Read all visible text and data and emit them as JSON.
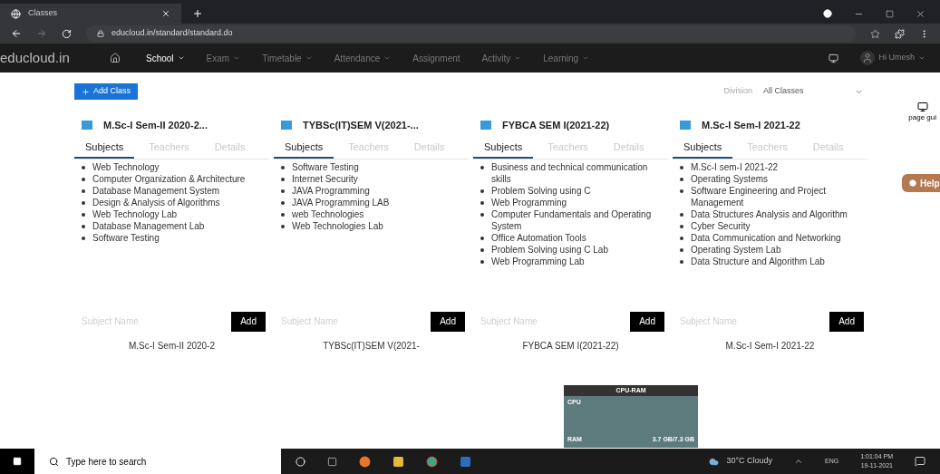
{
  "browser": {
    "tab_title": "Classes",
    "url": "educloud.in/standard/standard.do"
  },
  "navbar": {
    "brand": "educloud.in",
    "items": [
      {
        "label": "School",
        "dropdown": true,
        "selected": true
      },
      {
        "label": "Exam",
        "dropdown": true,
        "selected": false
      },
      {
        "label": "Timetable",
        "dropdown": true,
        "selected": false
      },
      {
        "label": "Attendance",
        "dropdown": true,
        "selected": false
      },
      {
        "label": "Assignment",
        "dropdown": false,
        "selected": false
      },
      {
        "label": "Activity",
        "dropdown": true,
        "selected": false
      },
      {
        "label": "Learning",
        "dropdown": true,
        "selected": false
      }
    ],
    "user": "Hi Umesh"
  },
  "toolbar": {
    "add_button": "Add Class",
    "division_label": "Division",
    "division_value": "All Classes"
  },
  "classes": [
    {
      "title": "M.Sc-I Sem-II 2020-2...",
      "tabs": [
        {
          "label": "Subjects",
          "selected": true
        },
        {
          "label": "Teachers",
          "selected": false
        },
        {
          "label": "Details",
          "selected": false
        }
      ],
      "subjects": [
        "Web Technology",
        "Computer Organization & Architecture",
        "Database Management System",
        "Design & Analysis of Algorithms",
        "Web Technology Lab",
        "Database Management Lab",
        "Software Testing"
      ],
      "placeholder": "Subject Name",
      "add": "Add",
      "caption": "M.Sc-I Sem-II 2020-2"
    },
    {
      "title": "TYBSc(IT)SEM V(2021-...",
      "tabs": [
        {
          "label": "Subjects",
          "selected": true
        },
        {
          "label": "Teachers",
          "selected": false
        },
        {
          "label": "Details",
          "selected": false
        }
      ],
      "subjects": [
        "Software Testing",
        "Internet Security",
        "JAVA Programming",
        "JAVA Programming LAB",
        "web Technologies",
        "Web Technologies Lab"
      ],
      "placeholder": "Subject Name",
      "add": "Add",
      "caption": "TYBSc(IT)SEM V(2021-"
    },
    {
      "title": "FYBCA SEM I(2021-22)",
      "tabs": [
        {
          "label": "Subjects",
          "selected": true
        },
        {
          "label": "Teachers",
          "selected": false
        },
        {
          "label": "Details",
          "selected": false
        }
      ],
      "subjects": [
        "Business and technical communication skills",
        "Problem Solving using C",
        "Web Programming",
        "Computer Fundamentals and Operating System",
        "Office Automation Tools",
        "Problem Solving using C Lab",
        "Web Programming Lab"
      ],
      "placeholder": "Subject Name",
      "add": "Add",
      "caption": "FYBCA SEM I(2021-22)"
    },
    {
      "title": "M.Sc-I Sem-I 2021-22",
      "tabs": [
        {
          "label": "Subjects",
          "selected": true
        },
        {
          "label": "Teachers",
          "selected": false
        },
        {
          "label": "Details",
          "selected": false
        }
      ],
      "subjects": [
        "M.Sc-I sem-I 2021-22",
        "Operating Systems",
        "Software Engineering and Project Management",
        "Data Structures Analysis and Algorithm",
        "Cyber Security",
        "Data Communication and Networking",
        "Operating System Lab",
        "Data Structure and Algorithm Lab"
      ],
      "placeholder": "Subject Name",
      "add": "Add",
      "caption": "M.Sc-I Sem-I 2021-22"
    }
  ],
  "side": {
    "page_guide": "page gui",
    "help": "Help"
  },
  "cpu_widget": {
    "title": "CPU-RAM",
    "cpu_label": "CPU",
    "ram_label": "RAM",
    "ram_value": "3.7 GB/7.3 GB"
  },
  "taskbar": {
    "search_placeholder": "Type here to search",
    "weather": "30°C Cloudy",
    "language": "ENG",
    "time": "1:01:04 PM",
    "date": "19-11-2021"
  }
}
